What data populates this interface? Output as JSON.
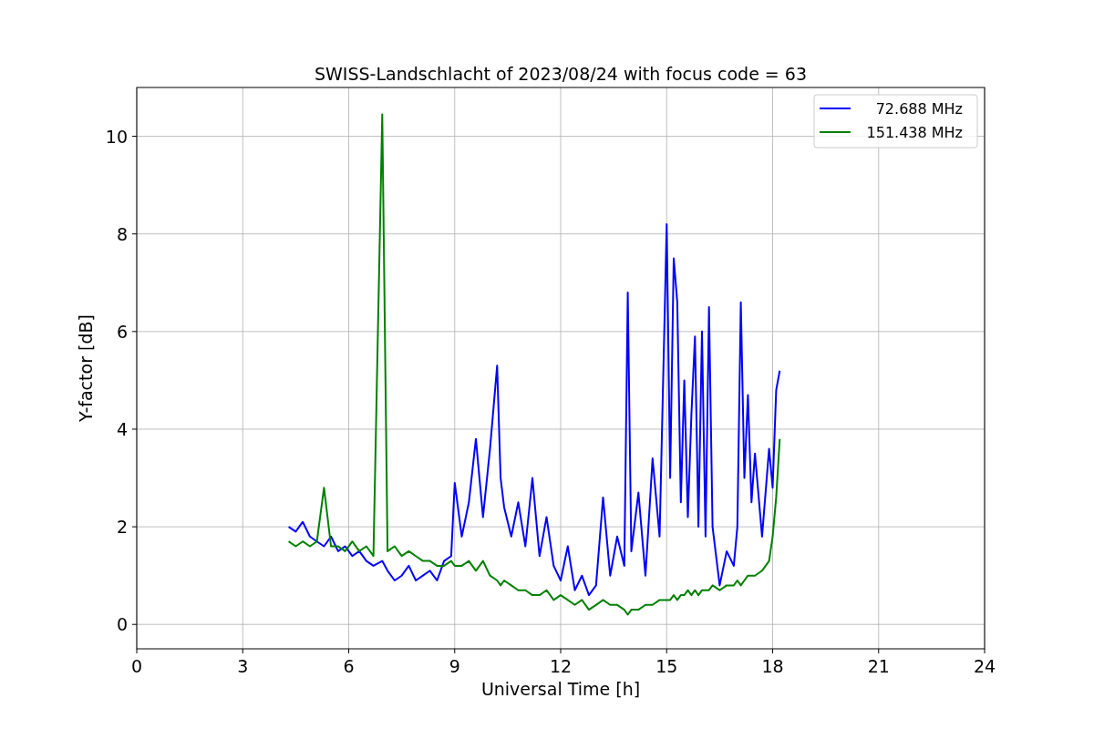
{
  "figure": {
    "chart_data": {
      "type": "line",
      "title": "SWISS-Landschlacht of 2023/08/24 with focus code = 63",
      "xlabel": "Universal Time [h]",
      "ylabel": "Y-factor [dB]",
      "xlim": [
        0,
        24
      ],
      "ylim": [
        -0.5,
        11
      ],
      "xticks": [
        0,
        3,
        6,
        9,
        12,
        15,
        18,
        21,
        24
      ],
      "yticks": [
        0,
        2,
        4,
        6,
        8,
        10
      ],
      "grid": true,
      "legend": true,
      "x": [
        4.3,
        4.5,
        4.7,
        4.9,
        5.1,
        5.3,
        5.5,
        5.7,
        5.9,
        6.1,
        6.3,
        6.5,
        6.7,
        6.95,
        7.1,
        7.3,
        7.5,
        7.7,
        7.9,
        8.1,
        8.3,
        8.5,
        8.7,
        8.9,
        9.0,
        9.2,
        9.4,
        9.6,
        9.8,
        10.0,
        10.2,
        10.3,
        10.4,
        10.6,
        10.8,
        11.0,
        11.2,
        11.4,
        11.6,
        11.8,
        12.0,
        12.2,
        12.4,
        12.6,
        12.8,
        13.0,
        13.2,
        13.4,
        13.6,
        13.8,
        13.9,
        14.0,
        14.2,
        14.4,
        14.6,
        14.8,
        15.0,
        15.1,
        15.2,
        15.3,
        15.4,
        15.5,
        15.6,
        15.7,
        15.8,
        15.9,
        16.0,
        16.1,
        16.2,
        16.3,
        16.5,
        16.7,
        16.9,
        17.0,
        17.1,
        17.2,
        17.3,
        17.4,
        17.5,
        17.7,
        17.9,
        18.0,
        18.1,
        18.2
      ],
      "series": [
        {
          "name": "72.688 MHz",
          "color": "#0000ff",
          "values": [
            2.0,
            1.9,
            2.1,
            1.8,
            1.7,
            1.6,
            1.8,
            1.5,
            1.6,
            1.4,
            1.5,
            1.3,
            1.2,
            1.3,
            1.1,
            0.9,
            1.0,
            1.2,
            0.9,
            1.0,
            1.1,
            0.9,
            1.3,
            1.4,
            2.9,
            1.8,
            2.5,
            3.8,
            2.2,
            3.6,
            5.3,
            3.0,
            2.4,
            1.8,
            2.5,
            1.6,
            3.0,
            1.4,
            2.2,
            1.2,
            0.9,
            1.6,
            0.7,
            1.0,
            0.6,
            0.8,
            2.6,
            1.0,
            1.8,
            1.2,
            6.8,
            1.5,
            2.7,
            1.0,
            3.4,
            1.8,
            8.2,
            3.0,
            7.5,
            6.6,
            2.5,
            5.0,
            2.2,
            4.3,
            5.9,
            2.0,
            6.0,
            1.8,
            6.5,
            2.0,
            0.8,
            1.5,
            1.2,
            2.0,
            6.6,
            3.0,
            4.7,
            2.5,
            3.5,
            1.8,
            3.6,
            2.8,
            4.8,
            5.2
          ]
        },
        {
          "name": "151.438 MHz",
          "color": "#008000",
          "values": [
            1.7,
            1.6,
            1.7,
            1.6,
            1.7,
            2.8,
            1.6,
            1.6,
            1.5,
            1.7,
            1.5,
            1.6,
            1.4,
            10.45,
            1.5,
            1.6,
            1.4,
            1.5,
            1.4,
            1.3,
            1.3,
            1.2,
            1.2,
            1.3,
            1.2,
            1.2,
            1.3,
            1.1,
            1.3,
            1.0,
            0.9,
            0.8,
            0.9,
            0.8,
            0.7,
            0.7,
            0.6,
            0.6,
            0.7,
            0.5,
            0.6,
            0.5,
            0.4,
            0.5,
            0.3,
            0.4,
            0.5,
            0.4,
            0.4,
            0.3,
            0.2,
            0.3,
            0.3,
            0.4,
            0.4,
            0.5,
            0.5,
            0.5,
            0.6,
            0.5,
            0.6,
            0.6,
            0.7,
            0.6,
            0.7,
            0.6,
            0.7,
            0.7,
            0.7,
            0.8,
            0.7,
            0.8,
            0.8,
            0.9,
            0.8,
            0.9,
            1.0,
            1.0,
            1.0,
            1.1,
            1.3,
            1.8,
            2.6,
            3.8
          ]
        }
      ]
    }
  }
}
